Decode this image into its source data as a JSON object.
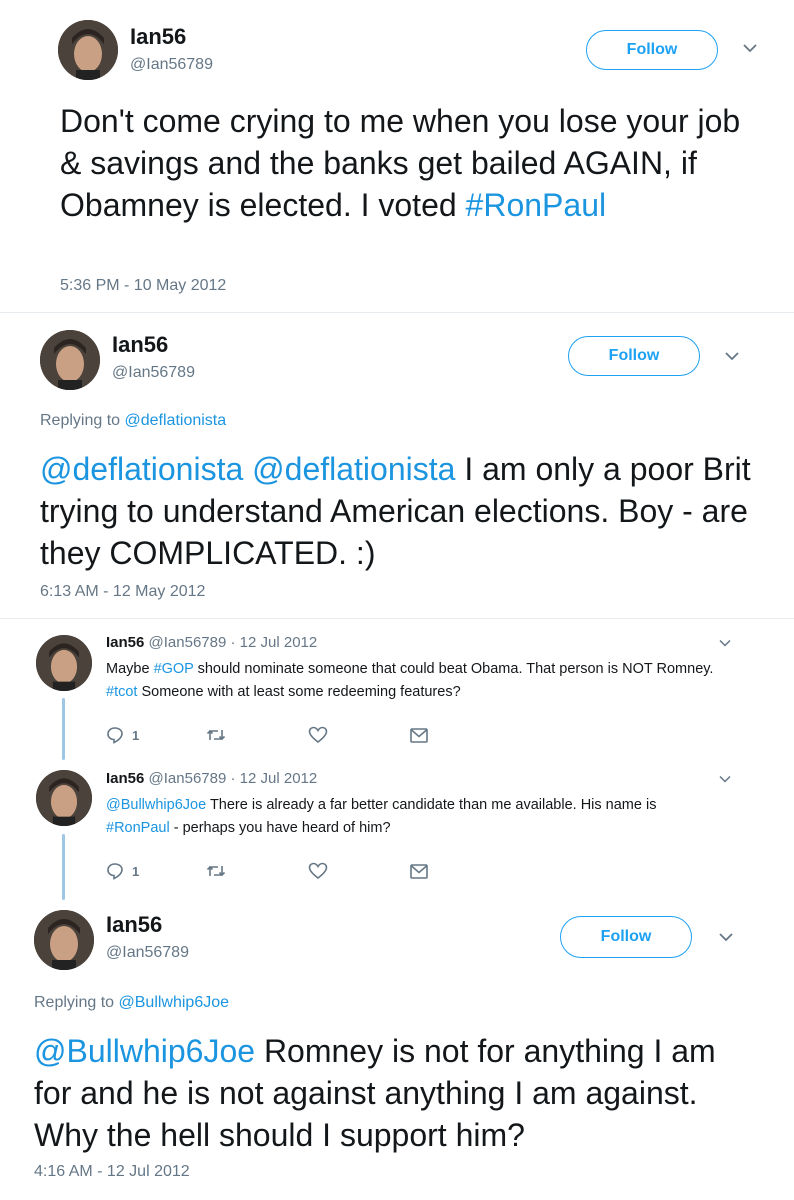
{
  "tweet1": {
    "name": "Ian56",
    "handle": "@Ian56789",
    "follow_label": "Follow",
    "text_before": "Don't come crying to me when you lose your job & savings and the banks get bailed AGAIN, if Obamney is elected. I voted ",
    "hashtag": "#RonPaul",
    "timestamp": "5:36 PM - 10 May 2012"
  },
  "tweet2": {
    "name": "Ian56",
    "handle": "@Ian56789",
    "follow_label": "Follow",
    "replying_prefix": "Replying to ",
    "replying_user": "@deflationista",
    "mention1": "@deflationista",
    "mention2": "@deflationista",
    "text_after": " I am only a poor Brit trying to understand American elections. Boy - are they COMPLICATED. :)",
    "timestamp": "6:13 AM - 12 May 2012"
  },
  "tweet3": {
    "name": "Ian56",
    "handle": "@Ian56789",
    "date": "· 12 Jul 2012",
    "text_part1": "Maybe ",
    "tag1": "#GOP",
    "text_part2": " should nominate someone that could beat Obama. That person is NOT Romney. ",
    "tag2": "#tcot",
    "text_part3": " Someone with at least some redeeming features?",
    "reply_count": "1"
  },
  "tweet4": {
    "name": "Ian56",
    "handle": "@Ian56789",
    "date": "· 12 Jul 2012",
    "mention": "@Bullwhip6Joe",
    "text_part1": " There is already a far better candidate than me available. His name is ",
    "tag": "#RonPaul",
    "text_part2": " - perhaps you have heard of him?",
    "reply_count": "1"
  },
  "tweet5": {
    "name": "Ian56",
    "handle": "@Ian56789",
    "follow_label": "Follow",
    "replying_prefix": "Replying to ",
    "replying_user": "@Bullwhip6Joe",
    "mention": "@Bullwhip6Joe",
    "text_after": " Romney is not for anything I am for and he is not against anything I am against. Why the hell should I support him?",
    "timestamp": "4:16 AM - 12 Jul 2012"
  },
  "colors": {
    "link_blue": "#1b95e0",
    "follow_blue": "#1da1f2",
    "muted_gray": "#657786",
    "text_dark": "#14171a",
    "thread_line": "#9cc8e6"
  },
  "icons": [
    "reply-icon",
    "retweet-icon",
    "like-icon",
    "message-icon",
    "chevron-down-icon"
  ]
}
